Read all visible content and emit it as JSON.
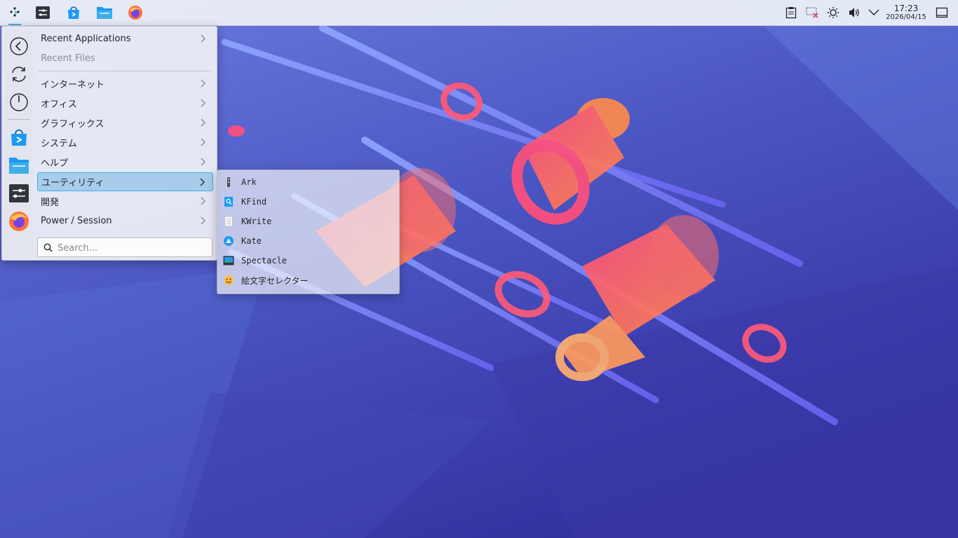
{
  "wallpaper": {
    "bg_top": "#5b6ad6",
    "bg_bottom": "#3433a0",
    "accent": "#ff5a6e"
  },
  "taskbar": {
    "launcher_icon": "app-launcher-icon",
    "pinned": [
      {
        "name": "system-settings",
        "icon": "sliders-icon"
      },
      {
        "name": "discover",
        "icon": "shopping-bag-icon"
      },
      {
        "name": "dolphin",
        "icon": "folder-icon"
      },
      {
        "name": "firefox",
        "icon": "firefox-icon"
      }
    ],
    "tray": [
      "clipboard-icon",
      "network-disconnected-icon",
      "brightness-icon",
      "volume-icon",
      "chevron-down-icon"
    ],
    "clock": {
      "time": "17:23",
      "date": "2026/04/15"
    },
    "show_desktop_icon": "show-desktop-icon"
  },
  "launcher": {
    "actions": [
      {
        "name": "back",
        "icon": "back-arrow-icon"
      },
      {
        "name": "refresh",
        "icon": "refresh-icon"
      },
      {
        "name": "power",
        "icon": "power-icon"
      }
    ],
    "favorites": [
      {
        "name": "discover",
        "icon": "shopping-bag-icon"
      },
      {
        "name": "dolphin",
        "icon": "folder-icon"
      },
      {
        "name": "system-settings",
        "icon": "sliders-icon"
      },
      {
        "name": "firefox",
        "icon": "firefox-icon"
      }
    ],
    "categories": [
      {
        "label": "Recent Applications"
      },
      {
        "label": "Recent Files"
      },
      {
        "label": "インターネット"
      },
      {
        "label": "オフィス"
      },
      {
        "label": "グラフィックス"
      },
      {
        "label": "システム"
      },
      {
        "label": "ヘルプ"
      },
      {
        "label": "ユーティリティ"
      },
      {
        "label": "開発"
      },
      {
        "label": "Power / Session"
      }
    ],
    "search": {
      "placeholder": "Search...",
      "value": ""
    }
  },
  "submenu": {
    "items": [
      {
        "label": "Ark",
        "icon": "archive-icon"
      },
      {
        "label": "KFind",
        "icon": "find-icon"
      },
      {
        "label": "KWrite",
        "icon": "text-editor-icon"
      },
      {
        "label": "Kate",
        "icon": "kate-icon"
      },
      {
        "label": "Spectacle",
        "icon": "screenshot-icon"
      },
      {
        "label": "絵文字セレクター",
        "icon": "emoji-icon"
      }
    ]
  }
}
